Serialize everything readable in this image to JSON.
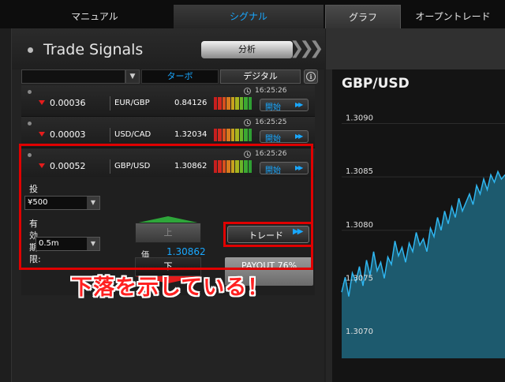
{
  "tabs": [
    "マニュアル",
    "シグナル",
    "グラフ",
    "オープントレード"
  ],
  "panel": {
    "title": "Trade Signals",
    "analysis_label": "分析",
    "filter_tabs": [
      "ターボ",
      "デジタル"
    ]
  },
  "signals": [
    {
      "change": "0.00036",
      "pair": "EUR/GBP",
      "price": "0.84126",
      "time": "16:25:26",
      "start": "開始"
    },
    {
      "change": "0.00003",
      "pair": "USD/CAD",
      "price": "1.32034",
      "time": "16:25:25",
      "start": "開始"
    },
    {
      "change": "0.00052",
      "pair": "GBP/USD",
      "price": "1.30862",
      "time": "16:25:26",
      "start": "開始"
    }
  ],
  "trade": {
    "investment_label": "投資",
    "investment_value": "¥500",
    "expiry_label": "有効期限:",
    "expiry_value": "0.5m",
    "up_label": "上",
    "down_label": "下",
    "price_label": "価",
    "price_value": "1.30862",
    "trade_label": "トレード",
    "payout": "PAYOUT 76%"
  },
  "annotation": "下落を示している！",
  "colors": {
    "accent": "#19a8ff",
    "highlight": "#e00000",
    "up": "#2ea63a",
    "down": "#e51c1c"
  },
  "chart_data": {
    "type": "area",
    "title": "GBP/USD",
    "ylim": [
      1.3068,
      1.3093
    ],
    "yticks": [
      "1.3090",
      "1.3085",
      "1.3080",
      "1.3075",
      "1.3070"
    ],
    "values": [
      1.30742,
      1.30756,
      1.30738,
      1.3076,
      1.30752,
      1.30766,
      1.30748,
      1.30772,
      1.30758,
      1.3078,
      1.30762,
      1.3077,
      1.30755,
      1.30775,
      1.30768,
      1.3079,
      1.30776,
      1.30784,
      1.3077,
      1.30788,
      1.3078,
      1.30798,
      1.30786,
      1.30792,
      1.3078,
      1.30802,
      1.30794,
      1.30812,
      1.308,
      1.30818,
      1.30806,
      1.30822,
      1.30812,
      1.3083,
      1.30818,
      1.30826,
      1.30834,
      1.30824,
      1.30842,
      1.30834,
      1.30848,
      1.30838,
      1.30852,
      1.30845,
      1.30855,
      1.30848,
      1.30852
    ]
  }
}
